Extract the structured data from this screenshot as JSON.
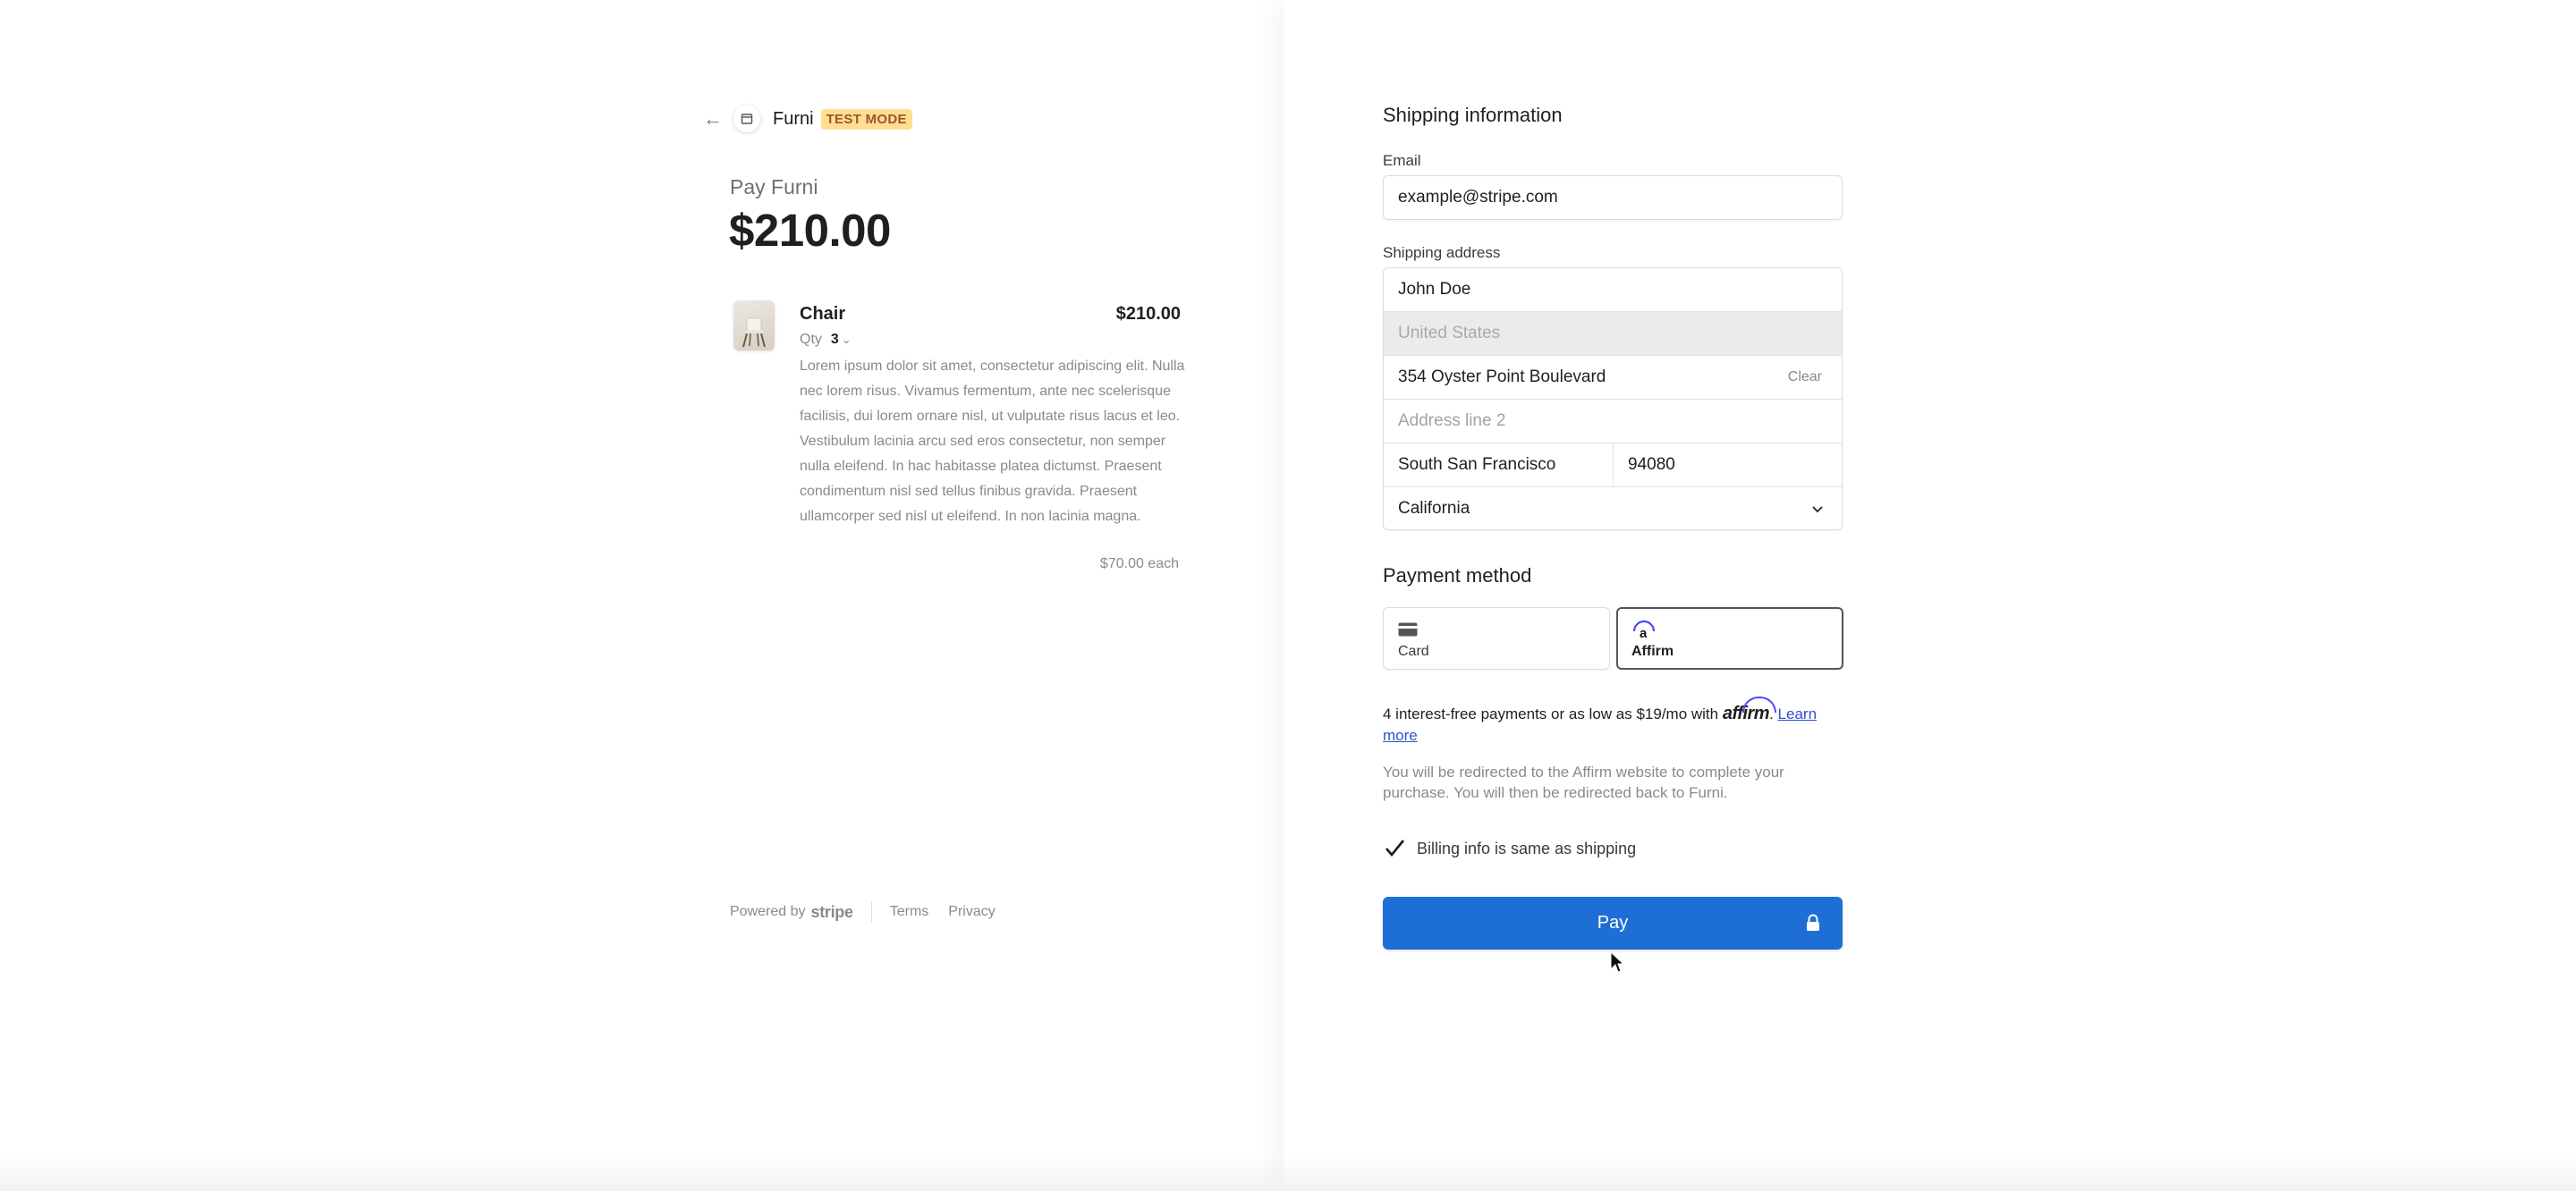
{
  "merchant": {
    "name": "Furni",
    "mode_badge": "TEST MODE",
    "pay_label": "Pay Furni",
    "total": "$210.00"
  },
  "product": {
    "name": "Chair",
    "price": "$210.00",
    "qty_label": "Qty",
    "qty_value": "3",
    "description": "Lorem ipsum dolor sit amet, consectetur adipiscing elit. Nulla nec lorem risus. Vivamus fermentum, ante nec scelerisque facilisis, dui lorem ornare nisl, ut vulputate risus lacus et leo. Vestibulum lacinia arcu sed eros consectetur, non semper nulla eleifend. In hac habitasse platea dictumst. Praesent condimentum nisl sed tellus finibus gravida. Praesent ullamcorper sed nisl ut eleifend. In non lacinia magna.",
    "unit_price": "$70.00 each"
  },
  "footer": {
    "powered_by": "Powered by",
    "brand": "stripe",
    "terms": "Terms",
    "privacy": "Privacy"
  },
  "shipping": {
    "title": "Shipping information",
    "email_label": "Email",
    "email_value": "example@stripe.com",
    "address_label": "Shipping address",
    "name_value": "John Doe",
    "country_value": "United States",
    "line1_value": "354 Oyster Point Boulevard",
    "clear_label": "Clear",
    "line2_placeholder": "Address line 2",
    "city_value": "South San Francisco",
    "zip_value": "94080",
    "state_value": "California"
  },
  "payment": {
    "title": "Payment method",
    "methods": [
      {
        "label": "Card",
        "icon": "card-icon",
        "selected": false
      },
      {
        "label": "Affirm",
        "icon": "affirm-icon",
        "selected": true
      }
    ],
    "affirm_text_before": "4 interest-free payments or as low as $19/mo with",
    "affirm_logo": "affirm",
    "affirm_sep": ".",
    "learn_more": "Learn more",
    "redirect_text": "You will be redirected to the Affirm website to complete your purchase. You will then be redirected back to Furni.",
    "billing_same_label": "Billing info is same as shipping",
    "billing_same_checked": true,
    "pay_button": "Pay"
  },
  "colors": {
    "pay_button": "#1d6fd6",
    "badge_bg": "#ffde92",
    "badge_text": "#a0522d"
  }
}
